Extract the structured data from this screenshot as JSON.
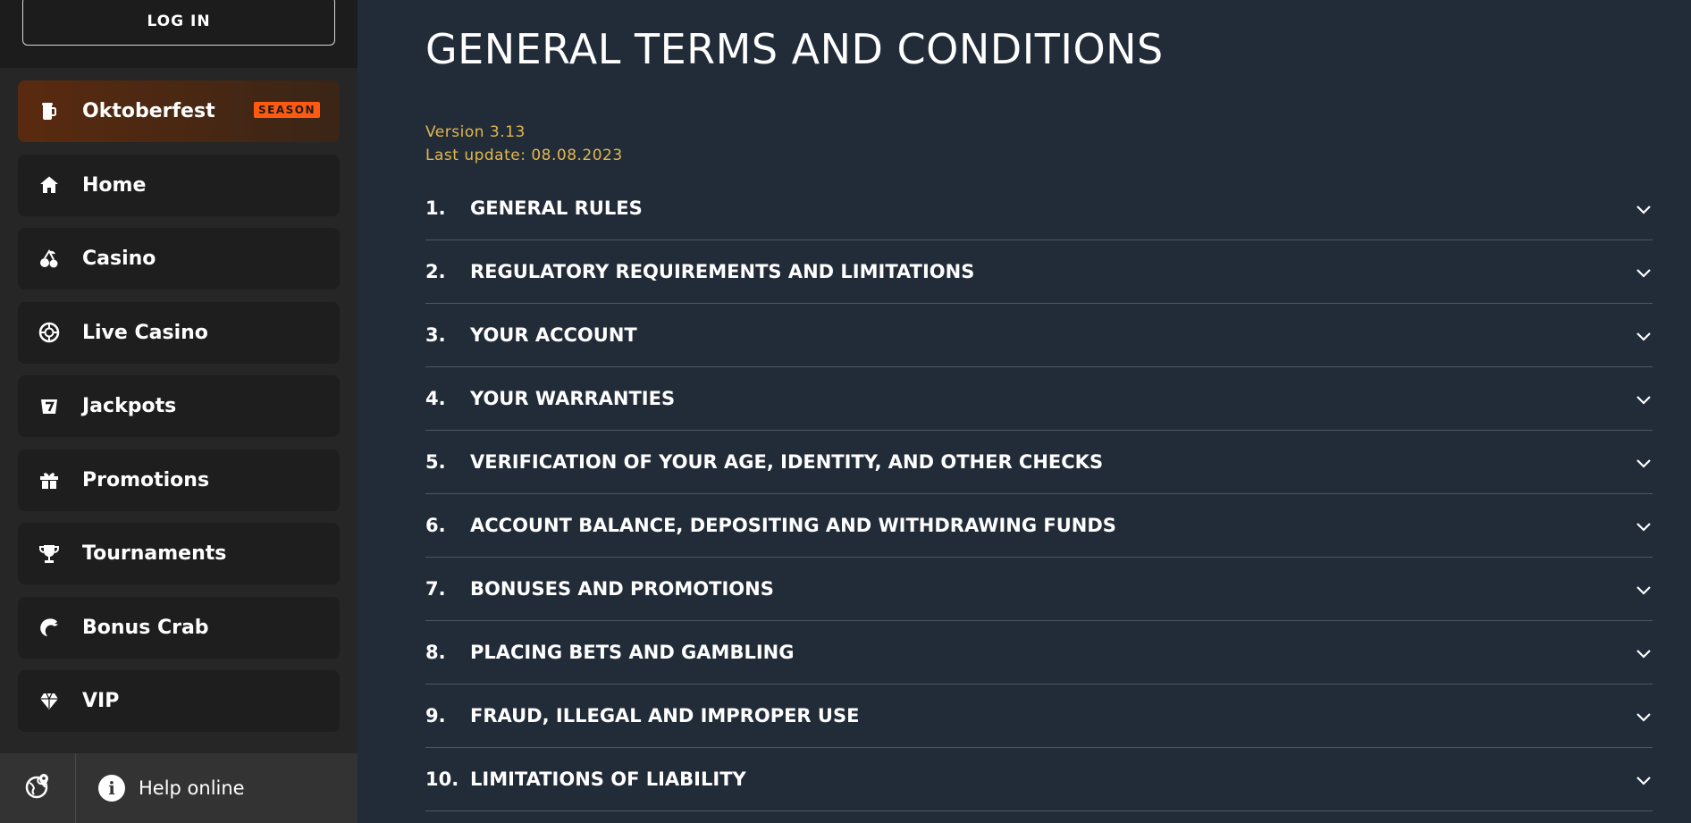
{
  "sidebar": {
    "login_label": "LOG IN",
    "items": [
      {
        "label": "Oktoberfest",
        "icon": "beer-mug-icon",
        "badge": "SEASON"
      },
      {
        "label": "Home",
        "icon": "home-icon"
      },
      {
        "label": "Casino",
        "icon": "cherries-icon"
      },
      {
        "label": "Live Casino",
        "icon": "poker-chip-icon"
      },
      {
        "label": "Jackpots",
        "icon": "slot-seven-icon"
      },
      {
        "label": "Promotions",
        "icon": "gift-icon"
      },
      {
        "label": "Tournaments",
        "icon": "trophy-icon"
      },
      {
        "label": "Bonus Crab",
        "icon": "crab-claw-icon"
      },
      {
        "label": "VIP",
        "icon": "diamond-icon"
      }
    ],
    "footer": {
      "globe_icon": "globe-pin-icon",
      "help_label": "Help online",
      "help_icon": "info-icon"
    }
  },
  "main": {
    "title": "GENERAL TERMS AND CONDITIONS",
    "version": "Version 3.13",
    "last_update": "Last update: 08.08.2023",
    "sections": [
      {
        "num": "1.",
        "title": "GENERAL RULES"
      },
      {
        "num": "2.",
        "title": "REGULATORY REQUIREMENTS AND LIMITATIONS"
      },
      {
        "num": "3.",
        "title": "YOUR ACCOUNT"
      },
      {
        "num": "4.",
        "title": "YOUR WARRANTIES"
      },
      {
        "num": "5.",
        "title": "VERIFICATION OF YOUR AGE, IDENTITY, AND OTHER CHECKS"
      },
      {
        "num": "6.",
        "title": "ACCOUNT BALANCE, DEPOSITING AND WITHDRAWING FUNDS"
      },
      {
        "num": "7.",
        "title": "BONUSES AND PROMOTIONS"
      },
      {
        "num": "8.",
        "title": "PLACING BETS AND GAMBLING"
      },
      {
        "num": "9.",
        "title": "FRAUD, ILLEGAL AND IMPROPER USE"
      },
      {
        "num": "10.",
        "title": "LIMITATIONS OF LIABILITY"
      }
    ]
  },
  "colors": {
    "main_bg": "#222b38",
    "sidebar_bg": "#262626",
    "accent_gold": "#e0b94f",
    "season_badge": "#ff5a10"
  }
}
